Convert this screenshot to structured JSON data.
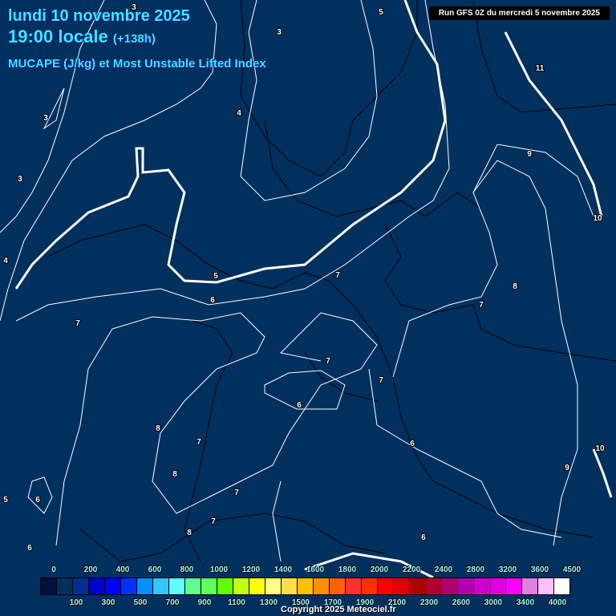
{
  "header": {
    "date": "lundi 10 novembre 2025",
    "time": "19:00 locale",
    "lead": "(+138h)",
    "parameter": "MUCAPE (J/kg) et Most Unstable Lifted Index",
    "run": "Run GFS 0Z du mercredi 5 novembre 2025"
  },
  "legend": {
    "colors": [
      "#001040",
      "#00305e",
      "#003090",
      "#0000d0",
      "#0000ff",
      "#0030ff",
      "#0090ff",
      "#30c8ff",
      "#60ffff",
      "#60ff90",
      "#60ff60",
      "#60ff00",
      "#c0ff10",
      "#ffff00",
      "#ffff80",
      "#ffe040",
      "#ffc000",
      "#ff9000",
      "#ff6000",
      "#ff3030",
      "#ff3000",
      "#ff0000",
      "#e00000",
      "#b00000",
      "#b00030",
      "#b00070",
      "#b000b0",
      "#d000d0",
      "#e000e0",
      "#ff00ff",
      "#e080e0",
      "#ffc0ff",
      "#ffffff"
    ],
    "top_labels": [
      "0",
      "200",
      "400",
      "600",
      "800",
      "1000",
      "1200",
      "1400",
      "1600",
      "1800",
      "2000",
      "2200",
      "2400",
      "2800",
      "3200",
      "3600",
      "4500"
    ],
    "bottom_labels": [
      "100",
      "300",
      "500",
      "700",
      "900",
      "1100",
      "1300",
      "1500",
      "1700",
      "1900",
      "2100",
      "2300",
      "2600",
      "3000",
      "3400",
      "4000"
    ]
  },
  "contour_labels": [
    "3",
    "3",
    "3",
    "3",
    "4",
    "4",
    "5",
    "5",
    "6",
    "6",
    "6",
    "6",
    "6",
    "6",
    "7",
    "7",
    "7",
    "7",
    "7",
    "7",
    "7",
    "7",
    "8",
    "8",
    "8",
    "8",
    "9",
    "9",
    "10",
    "10",
    "11",
    "5"
  ],
  "copyright": "Copyright 2025 Meteociel.fr"
}
